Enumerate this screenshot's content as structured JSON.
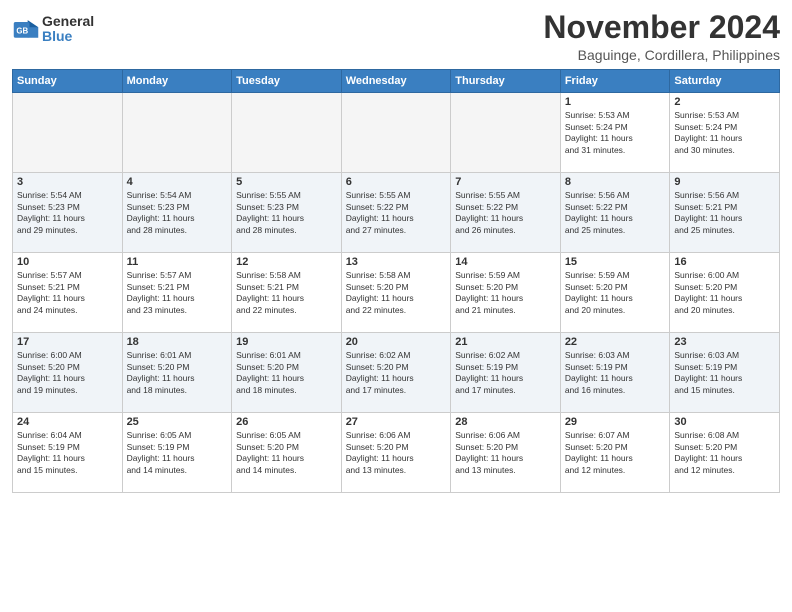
{
  "logo": {
    "general": "General",
    "blue": "Blue"
  },
  "header": {
    "month": "November 2024",
    "location": "Baguinge, Cordillera, Philippines"
  },
  "weekdays": [
    "Sunday",
    "Monday",
    "Tuesday",
    "Wednesday",
    "Thursday",
    "Friday",
    "Saturday"
  ],
  "weeks": [
    [
      {
        "day": "",
        "info": ""
      },
      {
        "day": "",
        "info": ""
      },
      {
        "day": "",
        "info": ""
      },
      {
        "day": "",
        "info": ""
      },
      {
        "day": "",
        "info": ""
      },
      {
        "day": "1",
        "info": "Sunrise: 5:53 AM\nSunset: 5:24 PM\nDaylight: 11 hours\nand 31 minutes."
      },
      {
        "day": "2",
        "info": "Sunrise: 5:53 AM\nSunset: 5:24 PM\nDaylight: 11 hours\nand 30 minutes."
      }
    ],
    [
      {
        "day": "3",
        "info": "Sunrise: 5:54 AM\nSunset: 5:23 PM\nDaylight: 11 hours\nand 29 minutes."
      },
      {
        "day": "4",
        "info": "Sunrise: 5:54 AM\nSunset: 5:23 PM\nDaylight: 11 hours\nand 28 minutes."
      },
      {
        "day": "5",
        "info": "Sunrise: 5:55 AM\nSunset: 5:23 PM\nDaylight: 11 hours\nand 28 minutes."
      },
      {
        "day": "6",
        "info": "Sunrise: 5:55 AM\nSunset: 5:22 PM\nDaylight: 11 hours\nand 27 minutes."
      },
      {
        "day": "7",
        "info": "Sunrise: 5:55 AM\nSunset: 5:22 PM\nDaylight: 11 hours\nand 26 minutes."
      },
      {
        "day": "8",
        "info": "Sunrise: 5:56 AM\nSunset: 5:22 PM\nDaylight: 11 hours\nand 25 minutes."
      },
      {
        "day": "9",
        "info": "Sunrise: 5:56 AM\nSunset: 5:21 PM\nDaylight: 11 hours\nand 25 minutes."
      }
    ],
    [
      {
        "day": "10",
        "info": "Sunrise: 5:57 AM\nSunset: 5:21 PM\nDaylight: 11 hours\nand 24 minutes."
      },
      {
        "day": "11",
        "info": "Sunrise: 5:57 AM\nSunset: 5:21 PM\nDaylight: 11 hours\nand 23 minutes."
      },
      {
        "day": "12",
        "info": "Sunrise: 5:58 AM\nSunset: 5:21 PM\nDaylight: 11 hours\nand 22 minutes."
      },
      {
        "day": "13",
        "info": "Sunrise: 5:58 AM\nSunset: 5:20 PM\nDaylight: 11 hours\nand 22 minutes."
      },
      {
        "day": "14",
        "info": "Sunrise: 5:59 AM\nSunset: 5:20 PM\nDaylight: 11 hours\nand 21 minutes."
      },
      {
        "day": "15",
        "info": "Sunrise: 5:59 AM\nSunset: 5:20 PM\nDaylight: 11 hours\nand 20 minutes."
      },
      {
        "day": "16",
        "info": "Sunrise: 6:00 AM\nSunset: 5:20 PM\nDaylight: 11 hours\nand 20 minutes."
      }
    ],
    [
      {
        "day": "17",
        "info": "Sunrise: 6:00 AM\nSunset: 5:20 PM\nDaylight: 11 hours\nand 19 minutes."
      },
      {
        "day": "18",
        "info": "Sunrise: 6:01 AM\nSunset: 5:20 PM\nDaylight: 11 hours\nand 18 minutes."
      },
      {
        "day": "19",
        "info": "Sunrise: 6:01 AM\nSunset: 5:20 PM\nDaylight: 11 hours\nand 18 minutes."
      },
      {
        "day": "20",
        "info": "Sunrise: 6:02 AM\nSunset: 5:20 PM\nDaylight: 11 hours\nand 17 minutes."
      },
      {
        "day": "21",
        "info": "Sunrise: 6:02 AM\nSunset: 5:19 PM\nDaylight: 11 hours\nand 17 minutes."
      },
      {
        "day": "22",
        "info": "Sunrise: 6:03 AM\nSunset: 5:19 PM\nDaylight: 11 hours\nand 16 minutes."
      },
      {
        "day": "23",
        "info": "Sunrise: 6:03 AM\nSunset: 5:19 PM\nDaylight: 11 hours\nand 15 minutes."
      }
    ],
    [
      {
        "day": "24",
        "info": "Sunrise: 6:04 AM\nSunset: 5:19 PM\nDaylight: 11 hours\nand 15 minutes."
      },
      {
        "day": "25",
        "info": "Sunrise: 6:05 AM\nSunset: 5:19 PM\nDaylight: 11 hours\nand 14 minutes."
      },
      {
        "day": "26",
        "info": "Sunrise: 6:05 AM\nSunset: 5:20 PM\nDaylight: 11 hours\nand 14 minutes."
      },
      {
        "day": "27",
        "info": "Sunrise: 6:06 AM\nSunset: 5:20 PM\nDaylight: 11 hours\nand 13 minutes."
      },
      {
        "day": "28",
        "info": "Sunrise: 6:06 AM\nSunset: 5:20 PM\nDaylight: 11 hours\nand 13 minutes."
      },
      {
        "day": "29",
        "info": "Sunrise: 6:07 AM\nSunset: 5:20 PM\nDaylight: 11 hours\nand 12 minutes."
      },
      {
        "day": "30",
        "info": "Sunrise: 6:08 AM\nSunset: 5:20 PM\nDaylight: 11 hours\nand 12 minutes."
      }
    ]
  ]
}
